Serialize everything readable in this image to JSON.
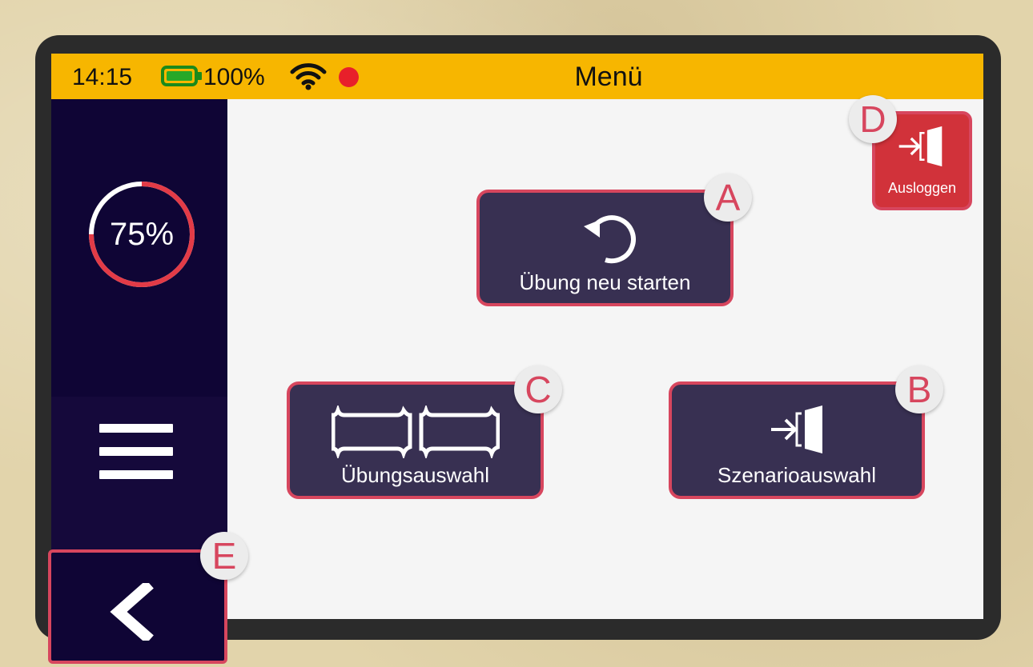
{
  "status": {
    "time": "14:15",
    "battery": "100%",
    "title": "Menü"
  },
  "sidebar": {
    "progress": {
      "label": "75%",
      "value": 0.75
    }
  },
  "main": {
    "tiles": {
      "restart": {
        "label": "Übung neu starten",
        "badge": "A"
      },
      "scenario": {
        "label": "Szenarioauswahl",
        "badge": "B"
      },
      "exercise": {
        "label": "Übungsauswahl",
        "badge": "C"
      }
    },
    "logout": {
      "label": "Ausloggen",
      "badge": "D"
    },
    "back": {
      "badge": "E"
    }
  },
  "colors": {
    "statusbar": "#f7b600",
    "sidebar": "#0f0535",
    "tile": "#383052",
    "highlight": "#d7465e",
    "logout": "#d1323a"
  }
}
